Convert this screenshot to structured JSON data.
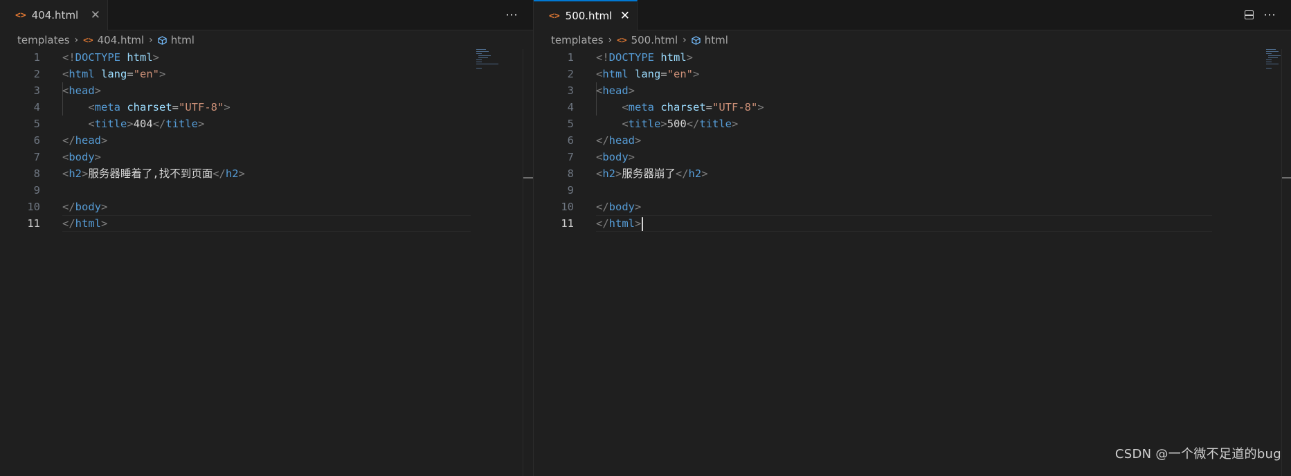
{
  "left_pane": {
    "tab": {
      "file_icon": "<>",
      "label": "404.html",
      "close": "✕"
    },
    "more_icon": "⋯",
    "breadcrumb": {
      "folder": "templates",
      "file": "404.html",
      "symbol": "html"
    },
    "current_line": 11,
    "lines": [
      {
        "n": "1"
      },
      {
        "n": "2"
      },
      {
        "n": "3"
      },
      {
        "n": "4"
      },
      {
        "n": "5"
      },
      {
        "n": "6"
      },
      {
        "n": "7"
      },
      {
        "n": "8"
      },
      {
        "n": "9"
      },
      {
        "n": "10"
      },
      {
        "n": "11"
      }
    ],
    "title_text": "404",
    "h2_text": "服务器睡着了,找不到页面"
  },
  "right_pane": {
    "tab": {
      "file_icon": "<>",
      "label": "500.html",
      "close": "✕"
    },
    "more_icon": "⋯",
    "split_icon": "split-editor-icon",
    "breadcrumb": {
      "folder": "templates",
      "file": "500.html",
      "symbol": "html"
    },
    "current_line": 11,
    "lines": [
      {
        "n": "1"
      },
      {
        "n": "2"
      },
      {
        "n": "3"
      },
      {
        "n": "4"
      },
      {
        "n": "5"
      },
      {
        "n": "6"
      },
      {
        "n": "7"
      },
      {
        "n": "8"
      },
      {
        "n": "9"
      },
      {
        "n": "10"
      },
      {
        "n": "11"
      }
    ],
    "title_text": "500",
    "h2_text": "服务器崩了"
  },
  "code": {
    "doctype_open": "<!",
    "doctype_kw": "DOCTYPE",
    "doctype_html": "html",
    "lt": "<",
    "gt": ">",
    "lt_slash": "</",
    "html": "html",
    "lang_attr": "lang",
    "eq": "=",
    "lang_val": "\"en\"",
    "head": "head",
    "meta": "meta",
    "charset_attr": "charset",
    "charset_val": "\"UTF-8\"",
    "title": "title",
    "body": "body",
    "h2": "h2"
  },
  "watermark": "CSDN @一个微不足道的bug",
  "colors": {
    "background": "#1f1f1f",
    "tab_active_border": "#0078d4",
    "file_icon": "#e37933",
    "tag": "#569cd6",
    "attr": "#9cdcfe",
    "string": "#ce9178"
  }
}
